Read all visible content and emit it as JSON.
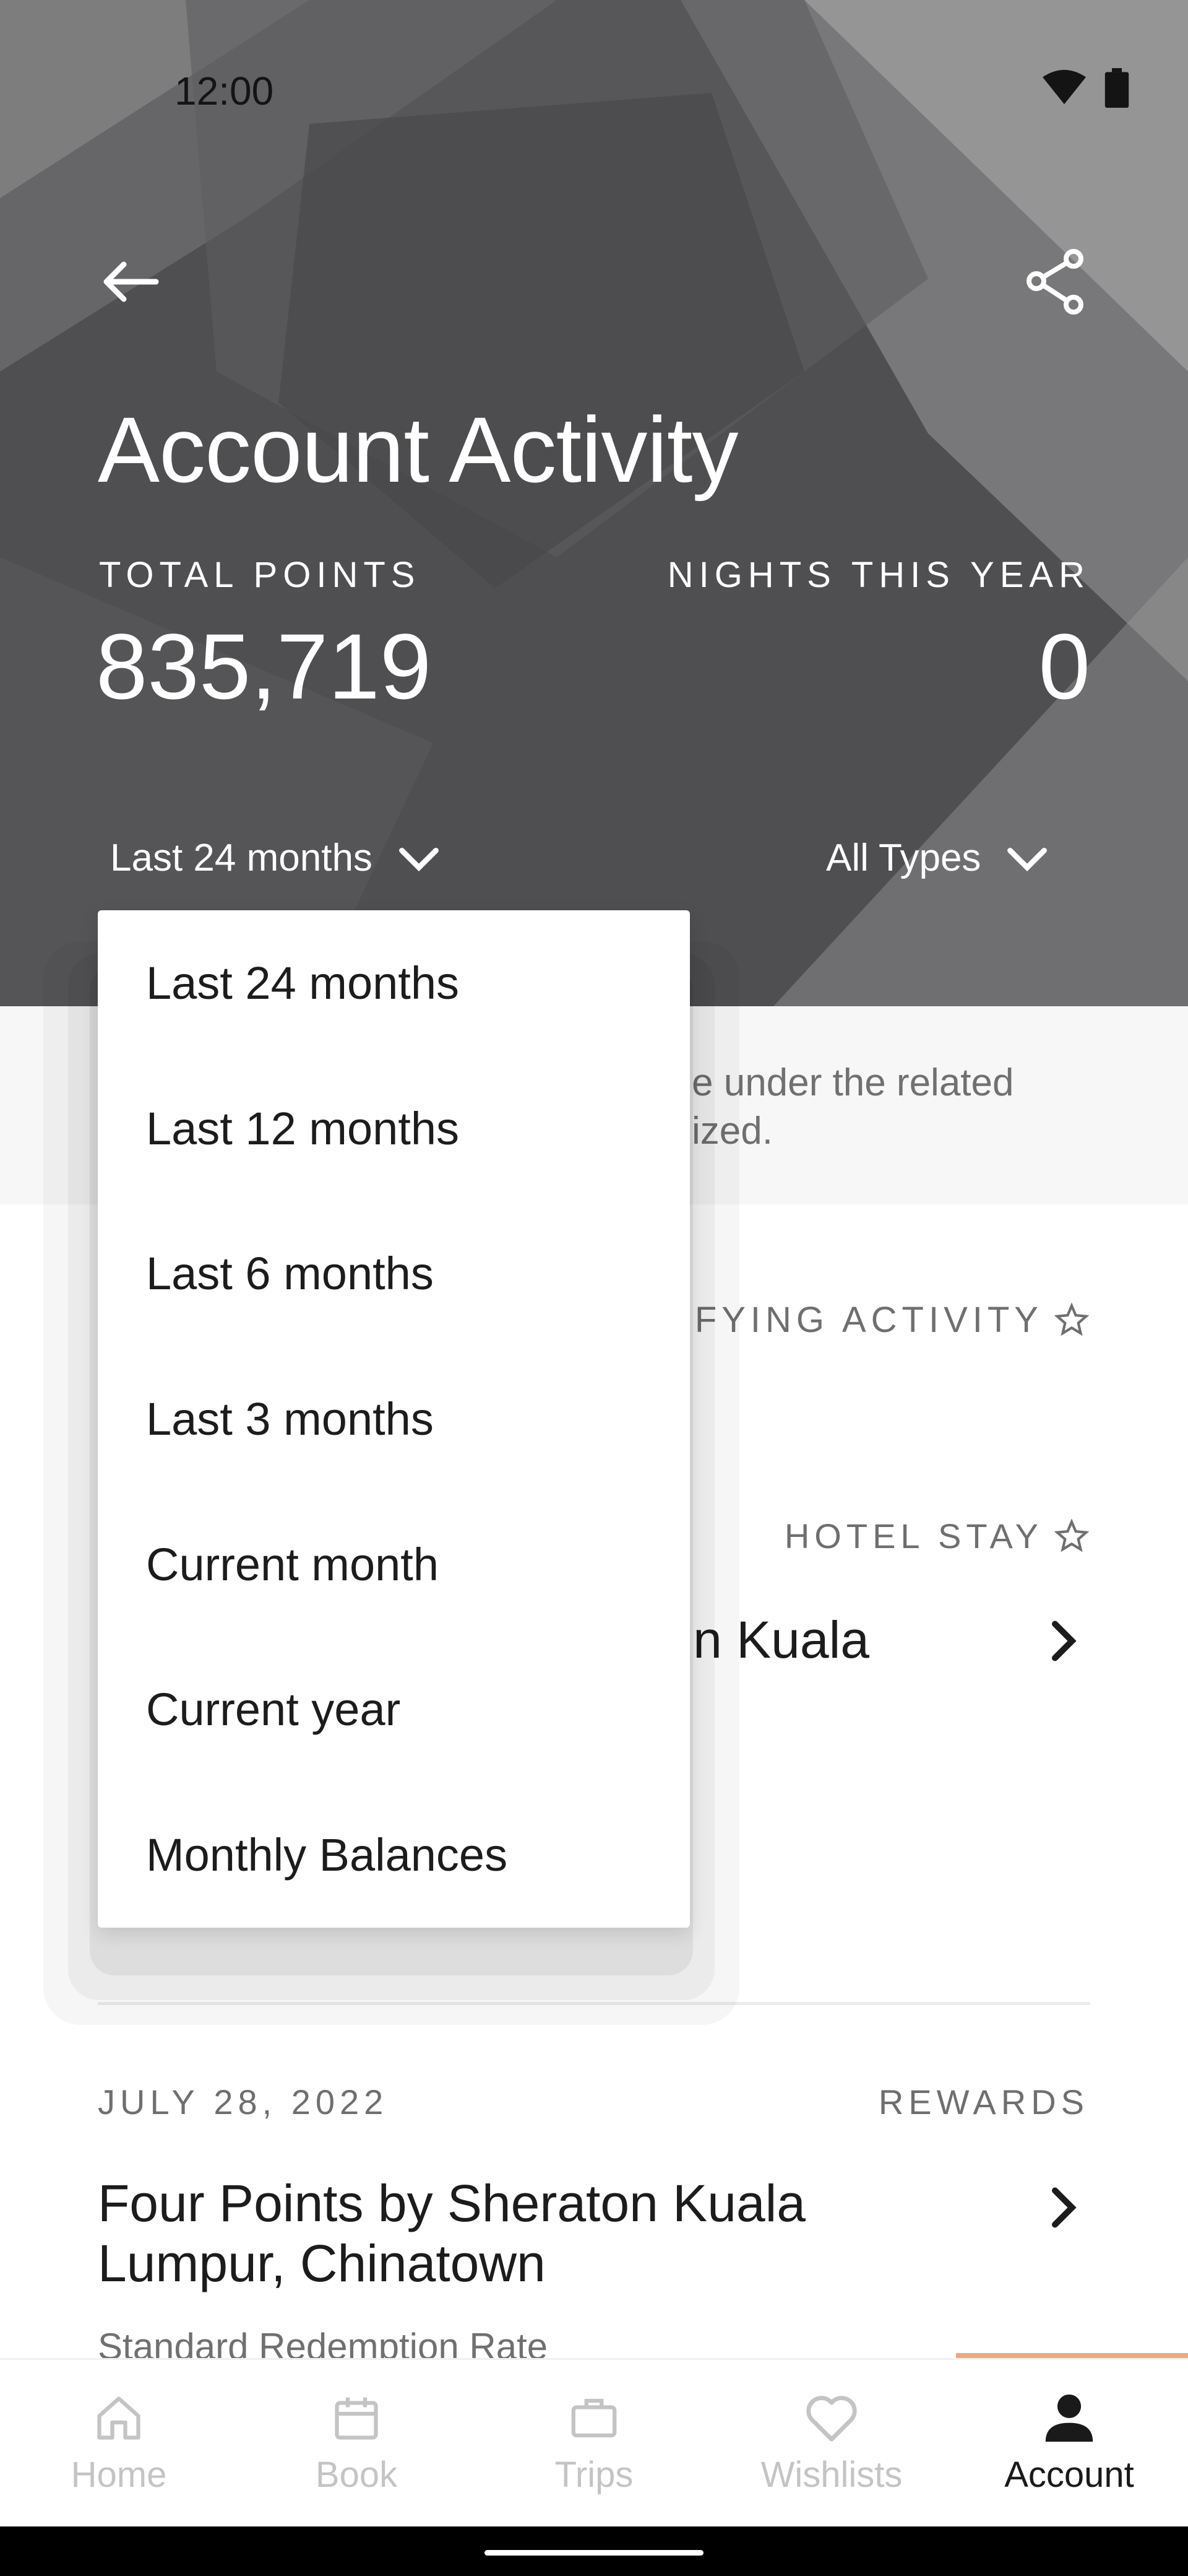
{
  "status_bar": {
    "time": "12:00",
    "icons": [
      "wifi-icon",
      "battery-icon"
    ]
  },
  "header": {
    "title": "Account Activity",
    "total_points_label": "TOTAL POINTS",
    "total_points_value": "835,719",
    "nights_label": "NIGHTS THIS YEAR",
    "nights_value": "0",
    "period_filter": "Last 24 months",
    "type_filter": "All Types"
  },
  "notice": {
    "text": "e under the related\nized."
  },
  "section": {
    "qualifying_label": "IFYING ACTIVITY"
  },
  "activities": [
    {
      "date": "",
      "type": "HOTEL STAY",
      "title": "n Kuala",
      "subtitle": ""
    },
    {
      "date": "JULY 28, 2022",
      "type": "REWARDS",
      "title": "Four Points by Sheraton Kuala Lumpur, Chinatown",
      "subtitle": "Standard Redemption Rate"
    }
  ],
  "dropdown": {
    "options": [
      "Last 24 months",
      "Last 12 months",
      "Last 6 months",
      "Last 3 months",
      "Current month",
      "Current year",
      "Monthly Balances"
    ]
  },
  "bottom_nav": {
    "items": [
      {
        "label": "Home",
        "icon": "home-icon"
      },
      {
        "label": "Book",
        "icon": "calendar-icon"
      },
      {
        "label": "Trips",
        "icon": "briefcase-icon"
      },
      {
        "label": "Wishlists",
        "icon": "heart-icon"
      },
      {
        "label": "Account",
        "icon": "person-icon"
      }
    ],
    "active": "Account"
  },
  "colors": {
    "accent": "#f0a583",
    "header_bg": "#5a5a5c"
  }
}
